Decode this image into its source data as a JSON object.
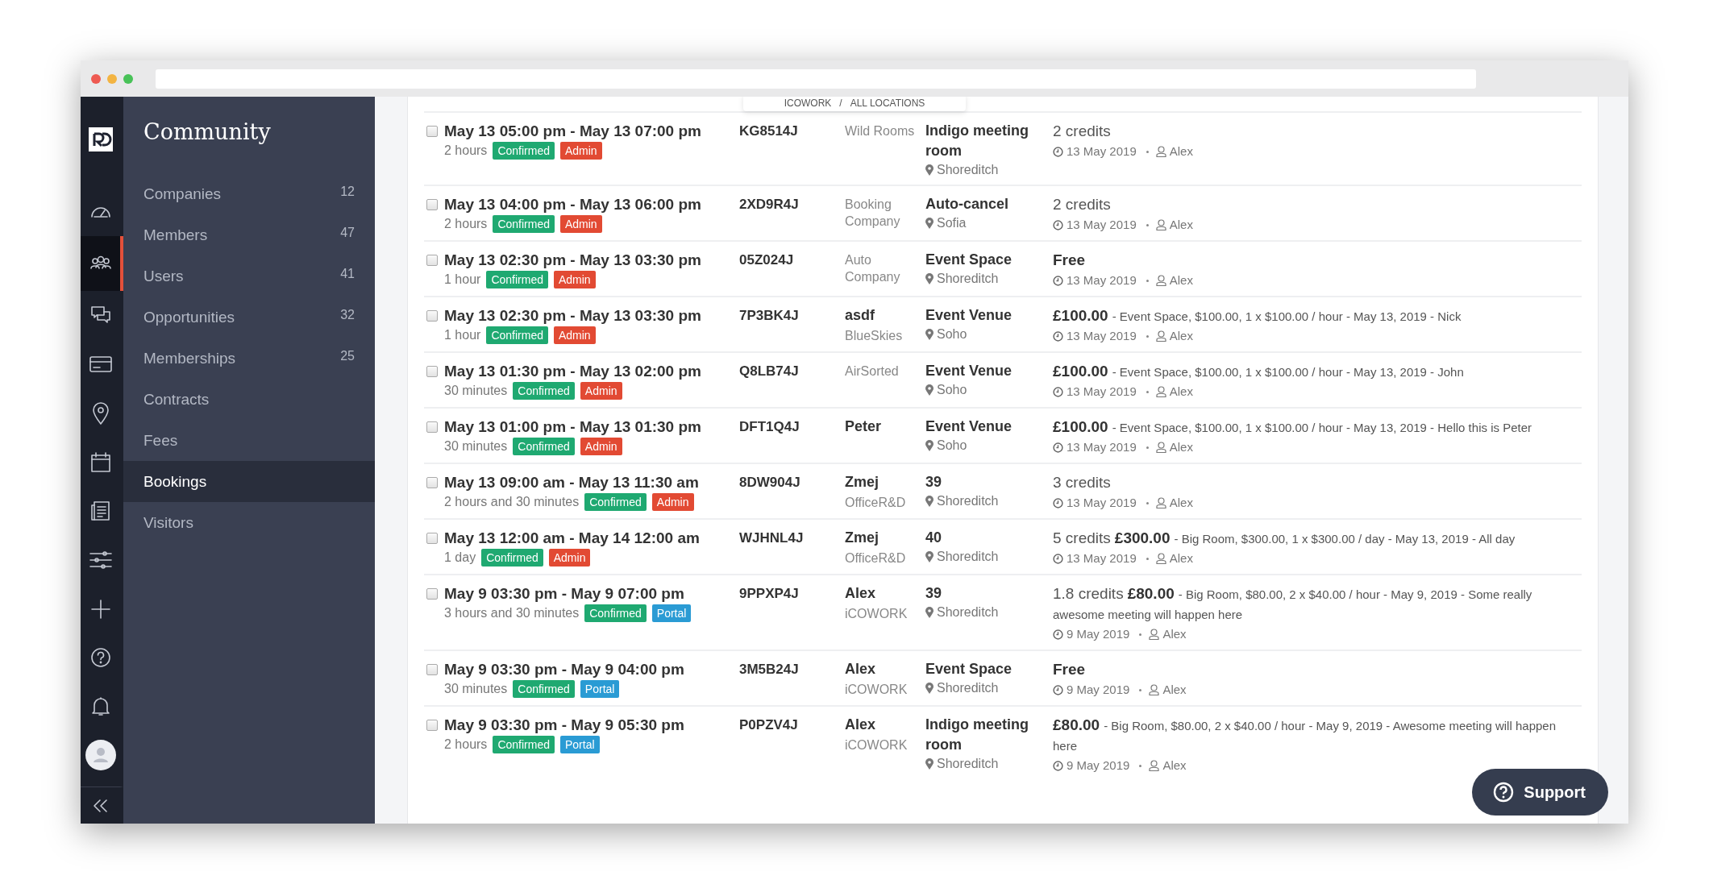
{
  "rail": [
    {
      "kind": "logo",
      "selected": false
    },
    {
      "kind": "dashboard",
      "selected": false
    },
    {
      "kind": "community",
      "selected": true
    },
    {
      "kind": "chat",
      "selected": false
    },
    {
      "kind": "card",
      "selected": false
    },
    {
      "kind": "pin",
      "selected": false
    },
    {
      "kind": "calendar",
      "selected": false
    },
    {
      "kind": "document",
      "selected": false
    },
    {
      "kind": "sliders",
      "selected": false
    },
    {
      "kind": "plus",
      "selected": false
    },
    {
      "kind": "help",
      "selected": false
    },
    {
      "kind": "bell",
      "selected": false
    },
    {
      "kind": "avatar",
      "selected": false
    },
    {
      "kind": "collapse",
      "selected": false
    }
  ],
  "sidebar": {
    "title": "Community",
    "items": [
      {
        "label": "Companies",
        "count": "12",
        "selected": false
      },
      {
        "label": "Members",
        "count": "47",
        "selected": false
      },
      {
        "label": "Users",
        "count": "41",
        "selected": false
      },
      {
        "label": "Opportunities",
        "count": "32",
        "selected": false
      },
      {
        "label": "Memberships",
        "count": "25",
        "selected": false
      },
      {
        "label": "Contracts",
        "selected": false
      },
      {
        "label": "Fees",
        "selected": false
      },
      {
        "label": "Bookings",
        "selected": true
      },
      {
        "label": "Visitors",
        "selected": false
      }
    ]
  },
  "breadcrumb": {
    "items": [
      "ICOWORK",
      "ALL LOCATIONS"
    ],
    "separator": "/"
  },
  "bookings": [
    {
      "checked": false,
      "when": "May 13 05:00 pm - May 13 07:00 pm",
      "duration": "2 hours",
      "badges": [
        {
          "label": "Confirmed",
          "color": "#1fa971"
        },
        {
          "label": "Admin",
          "color": "#e24a33"
        }
      ],
      "ref": "KG8514J",
      "company": "Wild Rooms",
      "space": "Indigo meeting room",
      "location": "Shoreditch",
      "credits": "2 credits",
      "date": "13 May 2019",
      "user": "Alex"
    },
    {
      "checked": false,
      "when": "May 13 04:00 pm - May 13 06:00 pm",
      "duration": "2 hours",
      "badges": [
        {
          "label": "Confirmed",
          "color": "#1fa971"
        },
        {
          "label": "Admin",
          "color": "#e24a33"
        }
      ],
      "ref": "2XD9R4J",
      "company": "Booking Company",
      "space": "Auto-cancel",
      "location": "Sofia",
      "credits": "2 credits",
      "date": "13 May 2019",
      "user": "Alex"
    },
    {
      "checked": false,
      "when": "May 13 02:30 pm - May 13 03:30 pm",
      "duration": "1 hour",
      "badges": [
        {
          "label": "Confirmed",
          "color": "#1fa971"
        },
        {
          "label": "Admin",
          "color": "#e24a33"
        }
      ],
      "ref": "05Z024J",
      "company": "Auto Company",
      "space": "Event Space",
      "location": "Shoreditch",
      "amount": "Free",
      "date": "13 May 2019",
      "user": "Alex"
    },
    {
      "checked": false,
      "when": "May 13 02:30 pm - May 13 03:30 pm",
      "duration": "1 hour",
      "badges": [
        {
          "label": "Confirmed",
          "color": "#1fa971"
        },
        {
          "label": "Admin",
          "color": "#e24a33"
        }
      ],
      "ref": "7P3BK4J",
      "member": "asdf",
      "company": "BlueSkies",
      "space": "Event Venue",
      "location": "Soho",
      "amount": "£100.00",
      "note": "- Event Space, $100.00, 1 x $100.00 / hour - May 13, 2019 - Nick",
      "date": "13 May 2019",
      "user": "Alex"
    },
    {
      "checked": false,
      "when": "May 13 01:30 pm - May 13 02:00 pm",
      "duration": "30 minutes",
      "badges": [
        {
          "label": "Confirmed",
          "color": "#1fa971"
        },
        {
          "label": "Admin",
          "color": "#e24a33"
        }
      ],
      "ref": "Q8LB74J",
      "company": "AirSorted",
      "space": "Event Venue",
      "location": "Soho",
      "amount": "£100.00",
      "note": "- Event Space, $100.00, 1 x $100.00 / hour - May 13, 2019 - John",
      "date": "13 May 2019",
      "user": "Alex"
    },
    {
      "checked": false,
      "when": "May 13 01:00 pm - May 13 01:30 pm",
      "duration": "30 minutes",
      "badges": [
        {
          "label": "Confirmed",
          "color": "#1fa971"
        },
        {
          "label": "Admin",
          "color": "#e24a33"
        }
      ],
      "ref": "DFT1Q4J",
      "member": "Peter",
      "space": "Event Venue",
      "location": "Soho",
      "amount": "£100.00",
      "note": "- Event Space, $100.00, 1 x $100.00 / hour - May 13, 2019 - Hello this is Peter",
      "date": "13 May 2019",
      "user": "Alex"
    },
    {
      "checked": false,
      "when": "May 13 09:00 am - May 13 11:30 am",
      "duration": "2 hours and 30 minutes",
      "badges": [
        {
          "label": "Confirmed",
          "color": "#1fa971"
        },
        {
          "label": "Admin",
          "color": "#e24a33"
        }
      ],
      "ref": "8DW904J",
      "member": "Zmej",
      "company": "OfficeR&D",
      "space": "39",
      "location": "Shoreditch",
      "credits": "3 credits",
      "date": "13 May 2019",
      "user": "Alex"
    },
    {
      "checked": false,
      "when": "May 13 12:00 am - May 14 12:00 am",
      "duration": "1 day",
      "badges": [
        {
          "label": "Confirmed",
          "color": "#1fa971"
        },
        {
          "label": "Admin",
          "color": "#e24a33"
        }
      ],
      "ref": "WJHNL4J",
      "member": "Zmej",
      "company": "OfficeR&D",
      "space": "40",
      "location": "Shoreditch",
      "credits": "5 credits",
      "amount": "£300.00",
      "note": "- Big Room, $300.00, 1 x $300.00 / day - May 13, 2019 - All day",
      "date": "13 May 2019",
      "user": "Alex"
    },
    {
      "checked": false,
      "when": "May 9 03:30 pm - May 9 07:00 pm",
      "duration": "3 hours and 30 minutes",
      "badges": [
        {
          "label": "Confirmed",
          "color": "#1fa971"
        },
        {
          "label": "Portal",
          "color": "#2a9bd4"
        }
      ],
      "ref": "9PPXP4J",
      "member": "Alex",
      "company": "iCOWORK",
      "space": "39",
      "location": "Shoreditch",
      "credits": "1.8 credits",
      "amount": "£80.00",
      "note": "- Big Room, $80.00, 2 x $40.00 / hour - May 9, 2019 - Some really awesome meeting will happen here",
      "date": "9 May 2019",
      "user": "Alex"
    },
    {
      "checked": false,
      "when": "May 9 03:30 pm - May 9 04:00 pm",
      "duration": "30 minutes",
      "badges": [
        {
          "label": "Confirmed",
          "color": "#1fa971"
        },
        {
          "label": "Portal",
          "color": "#2a9bd4"
        }
      ],
      "ref": "3M5B24J",
      "member": "Alex",
      "company": "iCOWORK",
      "space": "Event Space",
      "location": "Shoreditch",
      "amount": "Free",
      "date": "9 May 2019",
      "user": "Alex"
    },
    {
      "checked": false,
      "when": "May 9 03:30 pm - May 9 05:30 pm",
      "duration": "2 hours",
      "badges": [
        {
          "label": "Confirmed",
          "color": "#1fa971"
        },
        {
          "label": "Portal",
          "color": "#2a9bd4"
        }
      ],
      "ref": "P0PZV4J",
      "member": "Alex",
      "company": "iCOWORK",
      "space": "Indigo meeting room",
      "location": "Shoreditch",
      "amount": "£80.00",
      "note": "- Big Room, $80.00, 2 x $40.00 / hour - May 9, 2019 - Awesome meeting will happen here",
      "date": "9 May 2019",
      "user": "Alex"
    }
  ],
  "support_button": {
    "label": "Support"
  }
}
